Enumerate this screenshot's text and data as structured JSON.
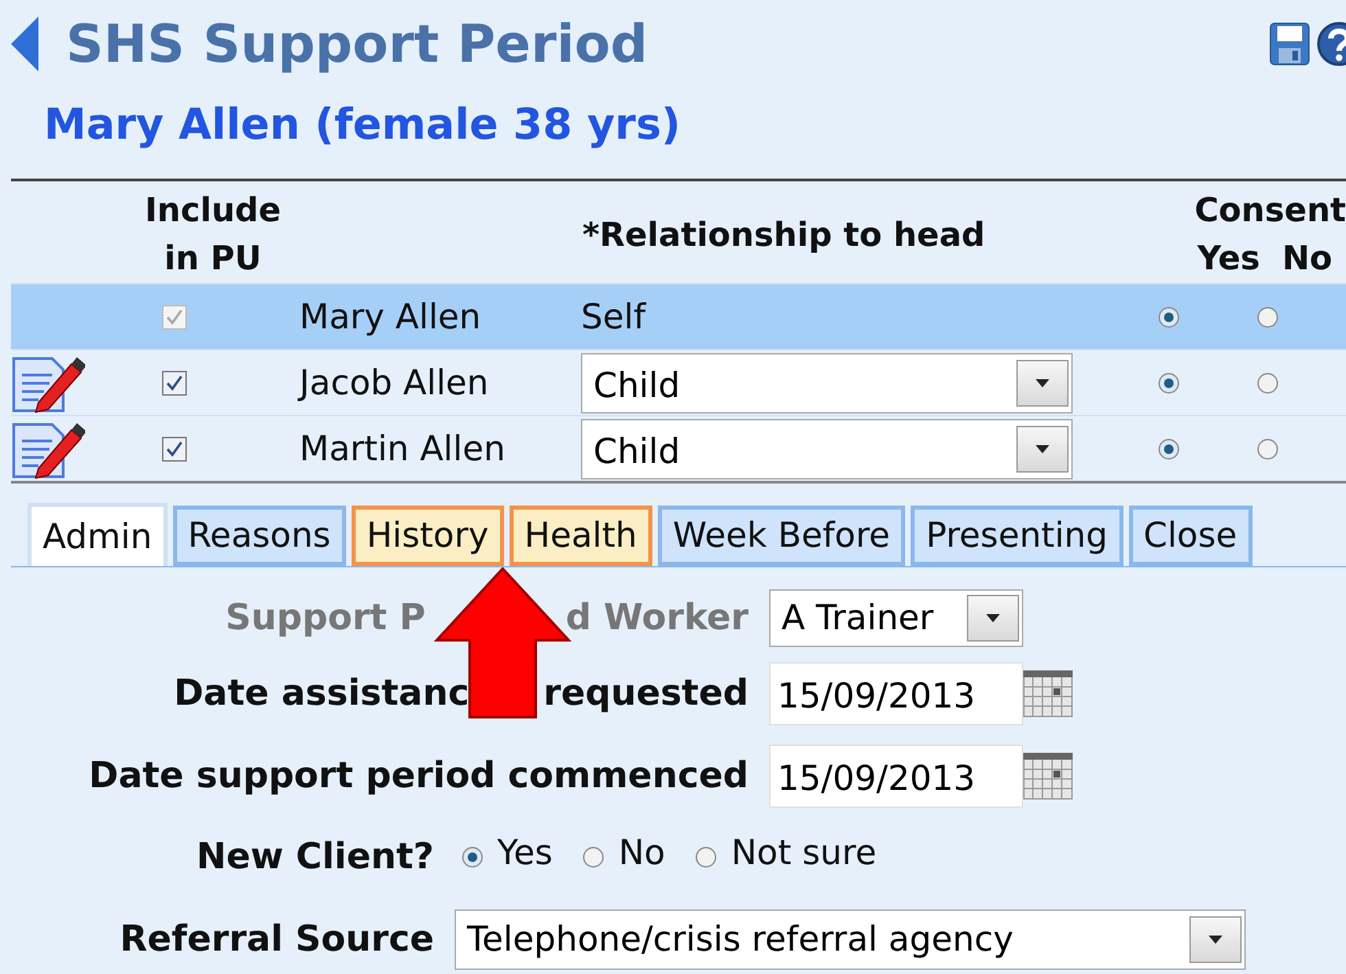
{
  "header": {
    "title": "SHS Support Period"
  },
  "client": {
    "title": "Mary Allen (female 38 yrs)"
  },
  "members": {
    "headers": {
      "include": "Include in PU",
      "relationship": "*Relationship to head",
      "consent": "Consent",
      "yes": "Yes",
      "no": "No"
    },
    "rows": [
      {
        "kind": "self",
        "name": "Mary Allen",
        "relationship": "Self",
        "included": true,
        "disabled": true,
        "consent_yes": true,
        "selected": true
      },
      {
        "kind": "member",
        "name": "Jacob Allen",
        "relationship": "Child",
        "included": true,
        "disabled": false,
        "consent_yes": true,
        "selected": false
      },
      {
        "kind": "member",
        "name": "Martin Allen",
        "relationship": "Child",
        "included": true,
        "disabled": false,
        "consent_yes": true,
        "selected": false
      }
    ]
  },
  "tabs": [
    {
      "label": "Admin",
      "selected": true,
      "highlighted": false
    },
    {
      "label": "Reasons",
      "selected": false,
      "highlighted": false
    },
    {
      "label": "History",
      "selected": false,
      "highlighted": true
    },
    {
      "label": "Health",
      "selected": false,
      "highlighted": true
    },
    {
      "label": "Week Before",
      "selected": false,
      "highlighted": false
    },
    {
      "label": "Presenting",
      "selected": false,
      "highlighted": false
    },
    {
      "label": "Close",
      "selected": false,
      "highlighted": false
    }
  ],
  "form": [
    {
      "kind": "select",
      "label": [
        "Support P",
        "d Worker"
      ],
      "value": "A Trainer",
      "disabled": true
    },
    {
      "kind": "date",
      "label": [
        "Date assistanc",
        "requested"
      ],
      "value": "15/09/2013",
      "disabled": false
    },
    {
      "kind": "date",
      "label": "Date support period commenced",
      "value": "15/09/2013",
      "disabled": false
    },
    {
      "kind": "radio",
      "label": "New Client?",
      "options": [
        {
          "label": "Yes",
          "selected": true
        },
        {
          "label": "No",
          "selected": false
        },
        {
          "label": "Not sure",
          "selected": false
        }
      ]
    },
    {
      "kind": "wide_select",
      "label": "Referral Source",
      "value": "Telephone/crisis referral agency"
    }
  ]
}
